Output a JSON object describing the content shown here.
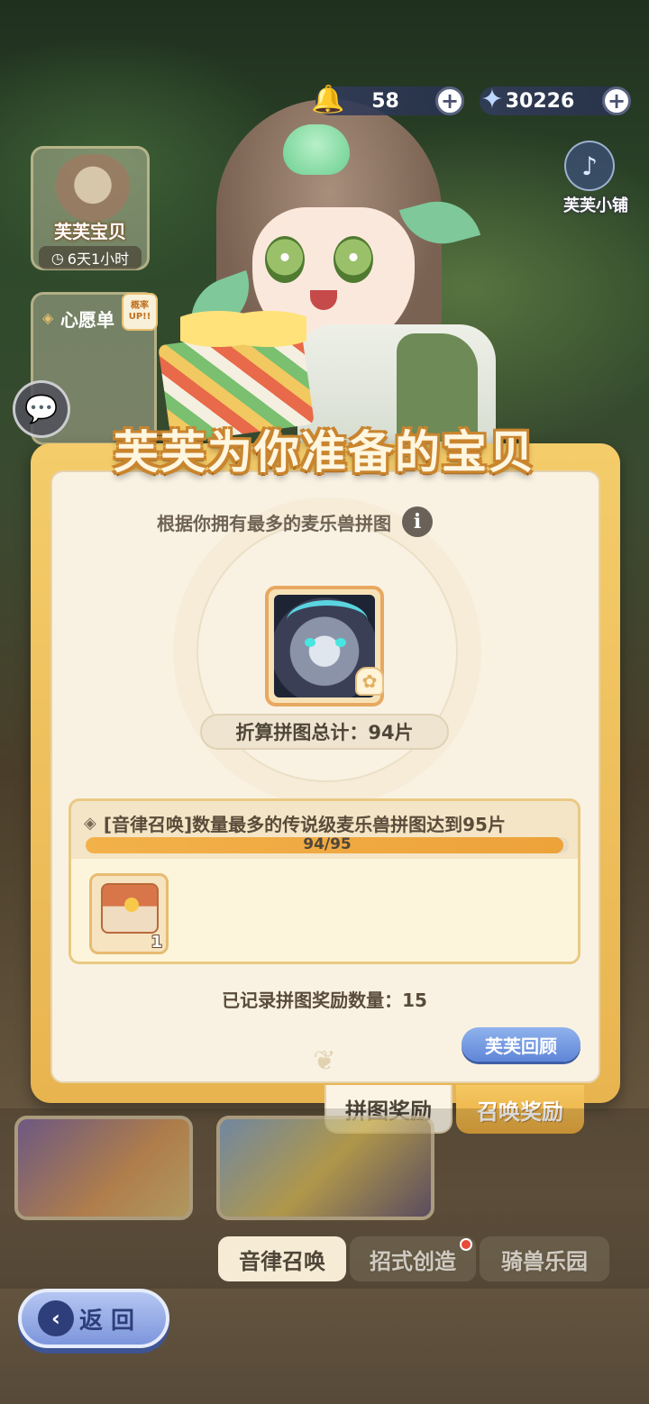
{
  "currency": {
    "bell": {
      "value": "58",
      "icon": "bell-icon"
    },
    "star": {
      "value": "30226",
      "icon": "star-icon"
    },
    "plus": "+"
  },
  "side": {
    "baby_card": {
      "label": "芙芙宝贝",
      "timer": "6天1小时"
    },
    "wish_card": {
      "label": "心愿单",
      "badge": "概率UP!!"
    }
  },
  "shop": {
    "label": "芙芙小铺"
  },
  "panel": {
    "title": "芙芙为你准备的宝贝",
    "subtitle": "根据你拥有最多的麦乐兽拼图",
    "info": "i",
    "total_label": "折算拼图总计：94片",
    "task": {
      "description": "[音律召唤]数量最多的传说级麦乐兽拼图达到95片",
      "progress_text": "94/95",
      "progress_current": 94,
      "progress_max": 95,
      "reward_count": "1"
    },
    "recorded": "已记录拼图奖励数量：15",
    "review_button": "芙芙回顾"
  },
  "panel_tabs": {
    "puzzle_reward": "拼图奖励",
    "summon_reward": "召唤奖励"
  },
  "bottom_tabs": {
    "rhythm_summon": "音律召唤",
    "move_create": "招式创造",
    "mount_park": "骑兽乐园"
  },
  "back_button": {
    "label": "返 回"
  },
  "colors": {
    "panel_gold": "#f4cc6a",
    "progress": "#eda23a",
    "review_blue": "#6f96e0",
    "back_blue": "#2e3e7a"
  }
}
